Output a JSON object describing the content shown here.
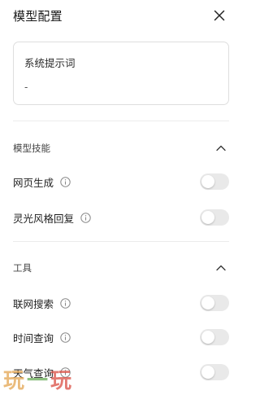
{
  "header": {
    "title": "模型配置"
  },
  "prompt": {
    "title": "系统提示词",
    "value": "-"
  },
  "sections": [
    {
      "title": "模型技能",
      "items": [
        {
          "label": "网页生成",
          "enabled": false
        },
        {
          "label": "灵光风格回复",
          "enabled": false
        }
      ]
    },
    {
      "title": "工具",
      "items": [
        {
          "label": "联网搜索",
          "enabled": false
        },
        {
          "label": "时间查询",
          "enabled": false
        },
        {
          "label": "天气查询",
          "enabled": false
        }
      ]
    }
  ],
  "watermark": {
    "text_1": "玩",
    "text_2": "一",
    "text_3": "玩"
  },
  "icons": {
    "close": "close-icon",
    "chevron": "chevron-up-icon",
    "info": "info-icon"
  },
  "colors": {
    "toggle_off": "#e9e9e9",
    "border": "#dedede",
    "divider": "#ececec"
  }
}
